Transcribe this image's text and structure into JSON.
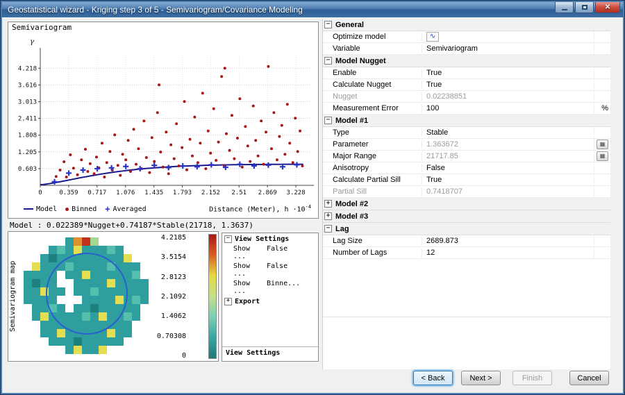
{
  "window": {
    "title": "Geostatistical wizard - Kriging step 3 of 5 - Semivariogram/Covariance Modeling"
  },
  "chart_panel": {
    "title": "Semivariogram",
    "xlabel_base": "Distance (Meter), h ·10",
    "xlabel_exp": "-4"
  },
  "model_text": "Model : 0.022389*Nugget+0.74187*Stable(21718, 1.3637)",
  "chart_data": {
    "type": "scatter",
    "title": "Semivariogram",
    "ylabel": "γ",
    "xlabel": "Distance (Meter), h ·10^-4",
    "xlim": [
      0,
      3.42
    ],
    "ylim": [
      0,
      4.75
    ],
    "grid": true,
    "legend_position": "bottom-left",
    "yticks": [
      "0.603",
      "1.205",
      "1.808",
      "2.411",
      "3.013",
      "3.616",
      "4.218"
    ],
    "xticks": [
      "0",
      "0.359",
      "0.717",
      "1.076",
      "1.435",
      "1.793",
      "2.152",
      "2.51",
      "2.869",
      "3.228"
    ],
    "series": [
      {
        "name": "Model",
        "type": "line",
        "color": "#1a1a8c",
        "model": {
          "form": "stable",
          "nugget": 0.022389,
          "partial_sill": 0.74187,
          "range_1e4": 2.1718,
          "shape": 1.3637
        }
      },
      {
        "name": "Binned",
        "type": "points",
        "color": "#a81818",
        "points": [
          [
            0.2,
            0.32
          ],
          [
            0.25,
            0.55
          ],
          [
            0.3,
            0.85
          ],
          [
            0.33,
            0.3
          ],
          [
            0.38,
            1.1
          ],
          [
            0.42,
            0.62
          ],
          [
            0.47,
            0.38
          ],
          [
            0.52,
            0.92
          ],
          [
            0.57,
            1.3
          ],
          [
            0.6,
            0.5
          ],
          [
            0.63,
            0.78
          ],
          [
            0.68,
            0.42
          ],
          [
            0.71,
            1.02
          ],
          [
            0.74,
            0.63
          ],
          [
            0.78,
            1.52
          ],
          [
            0.81,
            0.3
          ],
          [
            0.84,
            0.82
          ],
          [
            0.88,
            1.22
          ],
          [
            0.91,
            0.55
          ],
          [
            0.94,
            1.82
          ],
          [
            0.98,
            0.72
          ],
          [
            1.01,
            0.36
          ],
          [
            1.04,
            1.12
          ],
          [
            1.08,
            0.92
          ],
          [
            1.11,
            1.62
          ],
          [
            1.14,
            0.5
          ],
          [
            1.18,
            2.02
          ],
          [
            1.21,
            0.76
          ],
          [
            1.24,
            1.32
          ],
          [
            1.28,
            0.6
          ],
          [
            1.31,
            2.32
          ],
          [
            1.34,
            1.0
          ],
          [
            1.38,
            0.46
          ],
          [
            1.41,
            1.72
          ],
          [
            1.44,
            0.86
          ],
          [
            1.48,
            2.62
          ],
          [
            1.5,
            3.62
          ],
          [
            1.52,
            1.2
          ],
          [
            1.55,
            0.66
          ],
          [
            1.59,
            1.92
          ],
          [
            1.62,
            0.42
          ],
          [
            1.65,
            1.46
          ],
          [
            1.69,
            0.96
          ],
          [
            1.72,
            2.22
          ],
          [
            1.75,
            0.7
          ],
          [
            1.79,
            1.36
          ],
          [
            1.82,
            3.02
          ],
          [
            1.85,
            0.56
          ],
          [
            1.89,
            1.66
          ],
          [
            1.92,
            1.06
          ],
          [
            1.95,
            2.46
          ],
          [
            1.99,
            0.82
          ],
          [
            2.02,
            1.52
          ],
          [
            2.05,
            3.32
          ],
          [
            2.09,
            0.6
          ],
          [
            2.12,
            1.96
          ],
          [
            2.15,
            1.16
          ],
          [
            2.19,
            2.76
          ],
          [
            2.22,
            0.9
          ],
          [
            2.25,
            1.56
          ],
          [
            2.29,
            3.92
          ],
          [
            2.32,
            0.72
          ],
          [
            2.33,
            4.22
          ],
          [
            2.35,
            1.86
          ],
          [
            2.39,
            1.26
          ],
          [
            2.42,
            2.52
          ],
          [
            2.45,
            0.96
          ],
          [
            2.49,
            1.7
          ],
          [
            2.52,
            3.12
          ],
          [
            2.55,
            0.66
          ],
          [
            2.59,
            2.12
          ],
          [
            2.62,
            1.42
          ],
          [
            2.65,
            0.86
          ],
          [
            2.69,
            2.86
          ],
          [
            2.72,
            1.62
          ],
          [
            2.75,
            1.06
          ],
          [
            2.79,
            2.32
          ],
          [
            2.82,
            0.76
          ],
          [
            2.85,
            1.92
          ],
          [
            2.88,
            4.28
          ],
          [
            2.92,
            1.32
          ],
          [
            2.95,
            2.62
          ],
          [
            2.99,
            0.92
          ],
          [
            3.02,
            1.76
          ],
          [
            3.05,
            2.16
          ],
          [
            3.09,
            1.12
          ],
          [
            3.12,
            2.92
          ],
          [
            3.15,
            1.52
          ],
          [
            3.19,
            0.82
          ],
          [
            3.22,
            2.42
          ],
          [
            3.25,
            1.22
          ],
          [
            3.28,
            1.96
          ],
          [
            3.31,
            0.7
          ]
        ]
      },
      {
        "name": "Averaged",
        "type": "plus",
        "color": "#2a35c8",
        "points": [
          [
            0.18,
            0.13
          ],
          [
            0.36,
            0.44
          ],
          [
            0.54,
            0.55
          ],
          [
            0.72,
            0.6
          ],
          [
            0.9,
            0.63
          ],
          [
            1.08,
            0.68
          ],
          [
            1.26,
            0.6
          ],
          [
            1.44,
            0.72
          ],
          [
            1.62,
            0.64
          ],
          [
            1.8,
            0.7
          ],
          [
            1.98,
            0.67
          ],
          [
            2.16,
            0.74
          ],
          [
            2.34,
            0.65
          ],
          [
            2.52,
            0.76
          ],
          [
            2.7,
            0.7
          ],
          [
            2.88,
            0.73
          ],
          [
            3.06,
            0.67
          ],
          [
            3.24,
            0.74
          ]
        ]
      }
    ]
  },
  "map_panel": {
    "side_label": "Semivariogram map",
    "scale_labels": [
      "4.2185",
      "3.5154",
      "2.8123",
      "2.1092",
      "1.4062",
      "0.70308",
      "0"
    ],
    "ramp_colors": [
      "#a81818",
      "#d86020",
      "#e6da44",
      "#c3e088",
      "#7bd0b4",
      "#36a4a4",
      "#1f7878"
    ],
    "palette": {
      "w": "#ffffff",
      "t": "#2f9e9e",
      "c": "#55bfae",
      "g": "#a5d88f",
      "y": "#e3de52",
      "o": "#e0912f",
      "r": "#c23020",
      "d": "#1f8080"
    },
    "rows": [
      "wwwwwtorgwwwwww",
      "wwwtctytttctwww",
      "wwtdttttttttyww",
      "wytttcttttctttw",
      "ttttwttytttttcw",
      "tdttwwttttytttt",
      "ttyttwttctttttt",
      "ttttwwwttttytct",
      "wttctwttdtttttw",
      "wtyttttctyttctw",
      "wwtttttttttttww",
      "wwttytttttyttww",
      "wwwtttdtttttwww",
      "wwwwwtyttywwwww"
    ]
  },
  "view_settings": {
    "groups": [
      {
        "label": "View Settings",
        "state": "expanded",
        "rows": [
          {
            "label": "Show ...",
            "value": "False"
          },
          {
            "label": "Show ...",
            "value": "False"
          },
          {
            "label": "Show ...",
            "value": "Binne..."
          }
        ]
      },
      {
        "label": "Export",
        "state": "collapsed",
        "rows": []
      }
    ],
    "bottom_tab": "View Settings"
  },
  "property_grid": {
    "sections": [
      {
        "title": "General",
        "state": "expanded",
        "rows": [
          {
            "label": "Optimize model",
            "value": "",
            "icon": "optimize"
          },
          {
            "label": "Variable",
            "value": "Semivariogram"
          }
        ]
      },
      {
        "title": "Model Nugget",
        "state": "expanded",
        "rows": [
          {
            "label": "Enable",
            "value": "True"
          },
          {
            "label": "Calculate Nugget",
            "value": "True"
          },
          {
            "label": "Nugget",
            "value": "0.02238851",
            "muted": true,
            "muted_label": true
          },
          {
            "label": "Measurement Error",
            "value": "100",
            "suffix": "%"
          }
        ]
      },
      {
        "title": "Model #1",
        "state": "expanded",
        "rows": [
          {
            "label": "Type",
            "value": "Stable"
          },
          {
            "label": "Parameter",
            "value": "1.363672",
            "muted": true,
            "button": true
          },
          {
            "label": "Major Range",
            "value": "21717.85",
            "muted": true,
            "button": true
          },
          {
            "label": "Anisotropy",
            "value": "False"
          },
          {
            "label": "Calculate Partial Sill",
            "value": "True"
          },
          {
            "label": "Partial Sill",
            "value": "0.7418707",
            "muted": true,
            "muted_label": true
          }
        ]
      },
      {
        "title": "Model #2",
        "state": "collapsed",
        "rows": []
      },
      {
        "title": "Model #3",
        "state": "collapsed",
        "rows": []
      },
      {
        "title": "Lag",
        "state": "expanded",
        "rows": [
          {
            "label": "Lag Size",
            "value": "2689.873"
          },
          {
            "label": "Number of Lags",
            "value": "12"
          }
        ]
      }
    ]
  },
  "buttons": [
    {
      "label": "< Back",
      "state": "focused"
    },
    {
      "label": "Next >",
      "state": "normal"
    },
    {
      "label": "Finish",
      "state": "disabled"
    },
    {
      "label": "Cancel",
      "state": "normal"
    }
  ]
}
